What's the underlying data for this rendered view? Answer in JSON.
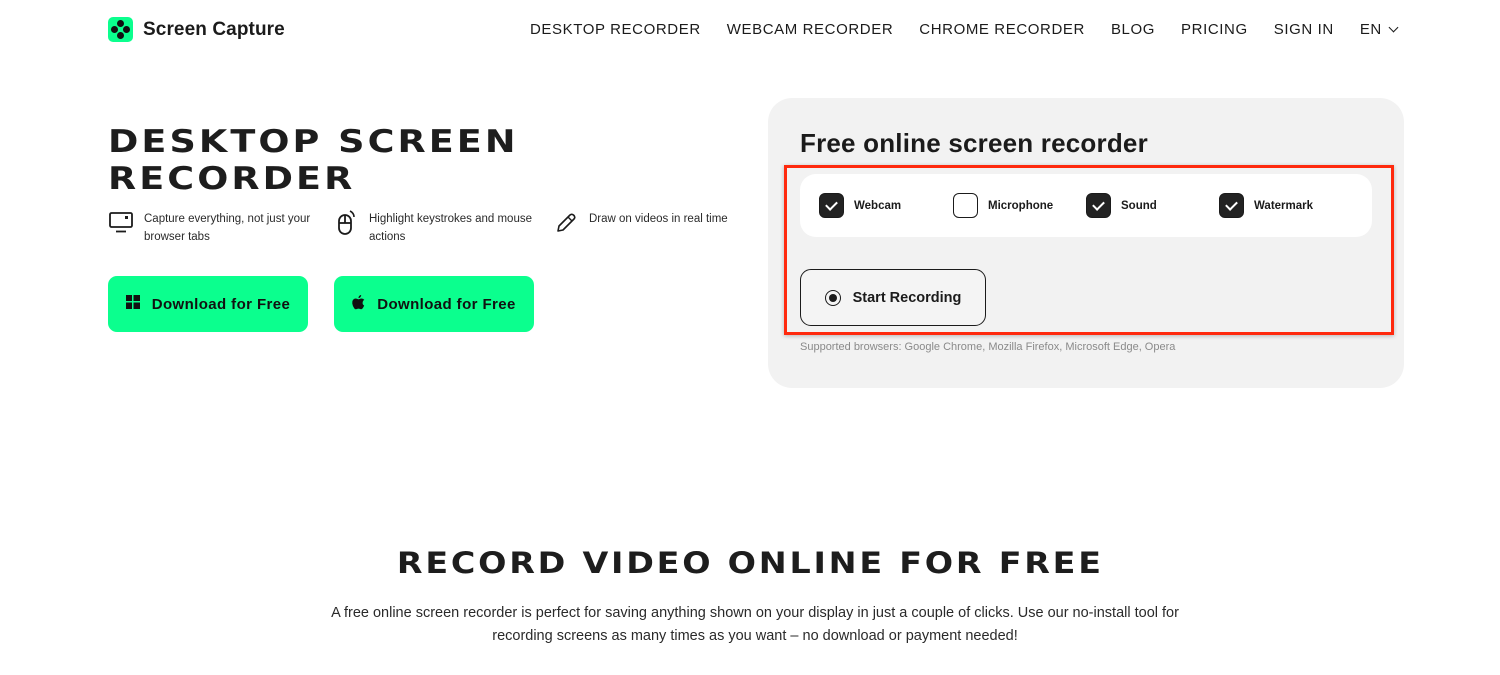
{
  "header": {
    "logo_text": "Screen Capture",
    "logo_icon": "screen-capture-logo-icon",
    "nav": [
      {
        "label": "DESKTOP RECORDER"
      },
      {
        "label": "WEBCAM RECORDER"
      },
      {
        "label": "CHROME RECORDER"
      },
      {
        "label": "BLOG"
      },
      {
        "label": "PRICING"
      },
      {
        "label": "SIGN IN"
      }
    ],
    "language": {
      "label": "EN",
      "icon": "chevron-down-icon"
    }
  },
  "hero": {
    "title_line1": "DESKTOP SCREEN",
    "title_line2": "RECORDER",
    "features": [
      {
        "icon": "monitor-icon",
        "text": "Capture everything, not just your browser tabs"
      },
      {
        "icon": "mouse-icon",
        "text": "Highlight keystrokes and mouse actions"
      },
      {
        "icon": "pencil-icon",
        "text": "Draw on videos in real time"
      }
    ],
    "download_windows": {
      "label": "Download for Free",
      "icon": "windows-icon"
    },
    "download_mac": {
      "label": "Download for Free",
      "icon": "apple-icon"
    },
    "accent_color": "#0bff8e"
  },
  "recorder": {
    "title": "Free online screen recorder",
    "options": [
      {
        "label": "Webcam",
        "checked": true
      },
      {
        "label": "Microphone",
        "checked": false
      },
      {
        "label": "Sound",
        "checked": true
      },
      {
        "label": "Watermark",
        "checked": true
      }
    ],
    "start_button": {
      "label": "Start Recording",
      "icon": "record-icon"
    },
    "supported_browsers": "Supported browsers: Google Chrome, Mozilla Firefox, Microsoft Edge, Opera",
    "highlight_color": "#ff2a0e"
  },
  "section": {
    "title": "RECORD VIDEO ONLINE FOR FREE",
    "text": "A free online screen recorder is perfect for saving anything shown on your display in just a couple of clicks. Use our no-install tool for recording screens as many times as you want – no download or payment needed!"
  }
}
